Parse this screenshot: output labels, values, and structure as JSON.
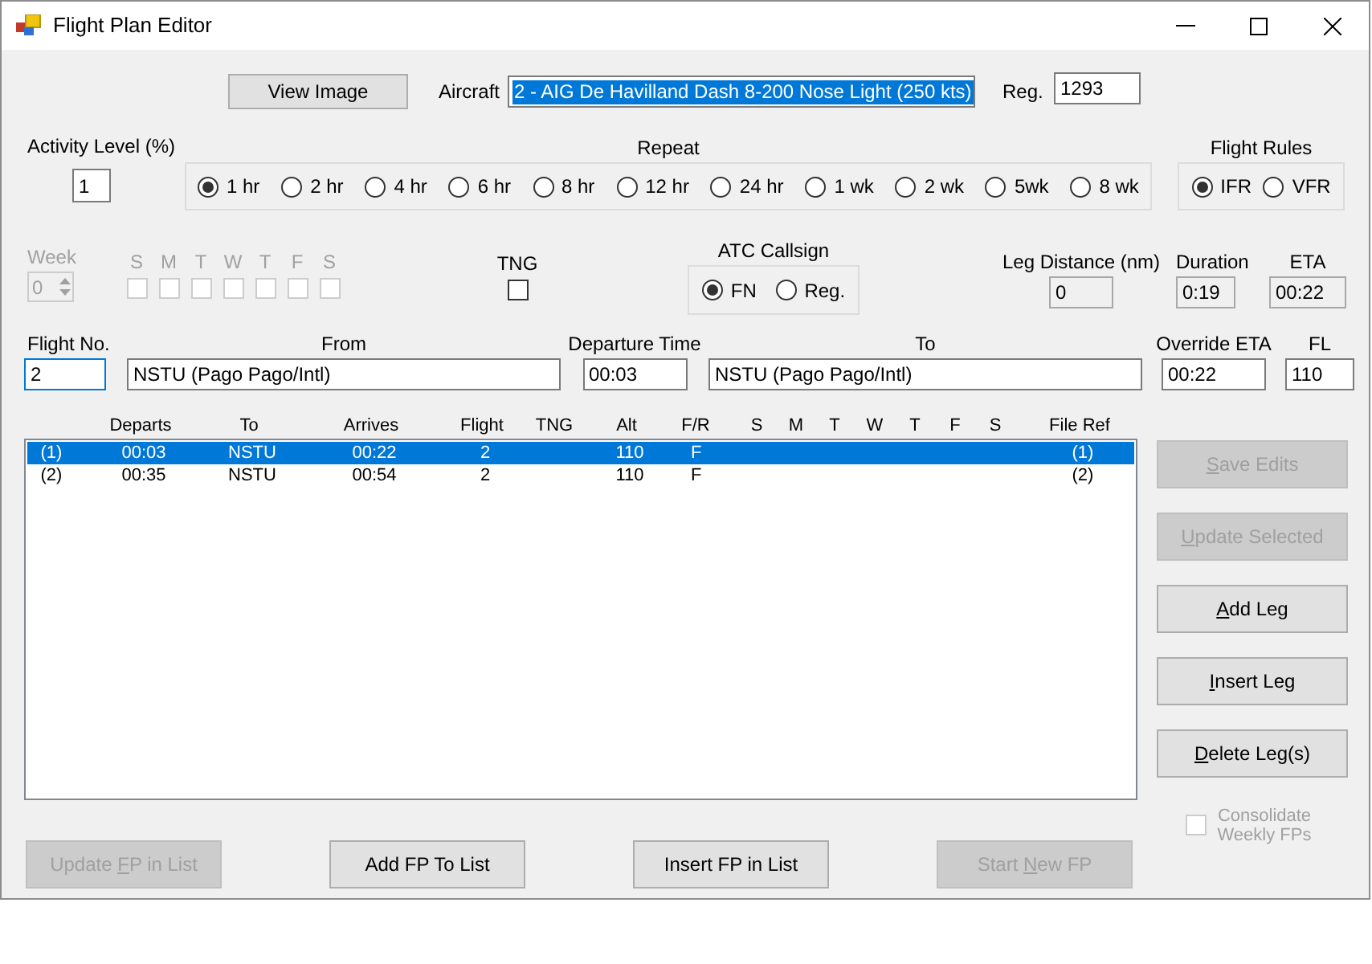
{
  "window": {
    "title": "Flight Plan Editor"
  },
  "view_image_button": {
    "label": "View Image",
    "disabled": false
  },
  "aircraft": {
    "label": "Aircraft",
    "value": "2 - AIG De Havilland Dash 8-200 Nose Light (250 kts)",
    "text_selected": true
  },
  "reg": {
    "label": "Reg.",
    "value": "1293"
  },
  "activity_level": {
    "label": "Activity Level (%)",
    "value": "1"
  },
  "repeat": {
    "label": "Repeat",
    "options": [
      {
        "label": "1 hr",
        "selected": true
      },
      {
        "label": "2 hr",
        "selected": false
      },
      {
        "label": "4 hr",
        "selected": false
      },
      {
        "label": "6 hr",
        "selected": false
      },
      {
        "label": "8 hr",
        "selected": false
      },
      {
        "label": "12 hr",
        "selected": false
      },
      {
        "label": "24 hr",
        "selected": false
      },
      {
        "label": "1 wk",
        "selected": false
      },
      {
        "label": "2 wk",
        "selected": false
      },
      {
        "label": "5wk",
        "selected": false
      },
      {
        "label": "8 wk",
        "selected": false
      }
    ]
  },
  "flight_rules": {
    "label": "Flight Rules",
    "options": [
      {
        "label": "IFR",
        "selected": true
      },
      {
        "label": "VFR",
        "selected": false
      }
    ]
  },
  "week": {
    "label": "Week",
    "value": "0",
    "disabled": true,
    "days": [
      {
        "label": "S",
        "checked": false
      },
      {
        "label": "M",
        "checked": false
      },
      {
        "label": "T",
        "checked": false
      },
      {
        "label": "W",
        "checked": false
      },
      {
        "label": "T",
        "checked": false
      },
      {
        "label": "F",
        "checked": false
      },
      {
        "label": "S",
        "checked": false
      }
    ]
  },
  "tng": {
    "label": "TNG",
    "checked": false
  },
  "atc_callsign": {
    "label": "ATC Callsign",
    "options": [
      {
        "label": "FN",
        "selected": true
      },
      {
        "label": "Reg.",
        "selected": false
      }
    ]
  },
  "leg_distance": {
    "label": "Leg Distance (nm)",
    "value": "0",
    "readonly": true
  },
  "duration": {
    "label": "Duration",
    "value": "0:19",
    "readonly": true
  },
  "eta": {
    "label": "ETA",
    "value": "00:22",
    "readonly": true
  },
  "flight_no": {
    "label": "Flight No.",
    "value": "2",
    "focused": true
  },
  "from": {
    "label": "From",
    "value": "NSTU (Pago Pago/Intl)"
  },
  "departure_time": {
    "label": "Departure Time",
    "value": "00:03"
  },
  "to": {
    "label": "To",
    "value": "NSTU (Pago Pago/Intl)"
  },
  "override_eta": {
    "label": "Override ETA",
    "value": "00:22"
  },
  "fl": {
    "label": "FL",
    "value": "110"
  },
  "legs": {
    "columns": [
      "Departs",
      "To",
      "Arrives",
      "Flight",
      "TNG",
      "Alt",
      "F/R",
      "S",
      "M",
      "T",
      "W",
      "T",
      "F",
      "S",
      "File Ref"
    ],
    "rows": [
      {
        "index": "(1)",
        "departs": "00:03",
        "to": "NSTU",
        "arrives": "00:22",
        "flight": "2",
        "alt": "110",
        "rules": "F",
        "file_ref": "(1)",
        "selected": true
      },
      {
        "index": "(2)",
        "departs": "00:35",
        "to": "NSTU",
        "arrives": "00:54",
        "flight": "2",
        "alt": "110",
        "rules": "F",
        "file_ref": "(2)",
        "selected": false
      }
    ]
  },
  "side_buttons": [
    {
      "key": "S",
      "post": "ave Edits",
      "disabled": true
    },
    {
      "key": "U",
      "post": "pdate Selected",
      "disabled": true
    },
    {
      "key": "A",
      "post": "dd Leg",
      "disabled": false
    },
    {
      "key": "I",
      "post": "nsert Leg",
      "disabled": false
    },
    {
      "key": "D",
      "post": "elete Leg(s)",
      "disabled": false
    }
  ],
  "consolidate": {
    "label": "Consolidate Weekly FPs",
    "checked": false,
    "disabled": true
  },
  "bottom_buttons": [
    {
      "pre": "Update ",
      "key": "F",
      "post": "P in List",
      "disabled": true
    },
    {
      "label": "Add FP To List",
      "disabled": false
    },
    {
      "label": "Insert FP in List",
      "disabled": false
    },
    {
      "pre": "Start ",
      "key": "N",
      "post": "ew FP",
      "disabled": true
    }
  ]
}
